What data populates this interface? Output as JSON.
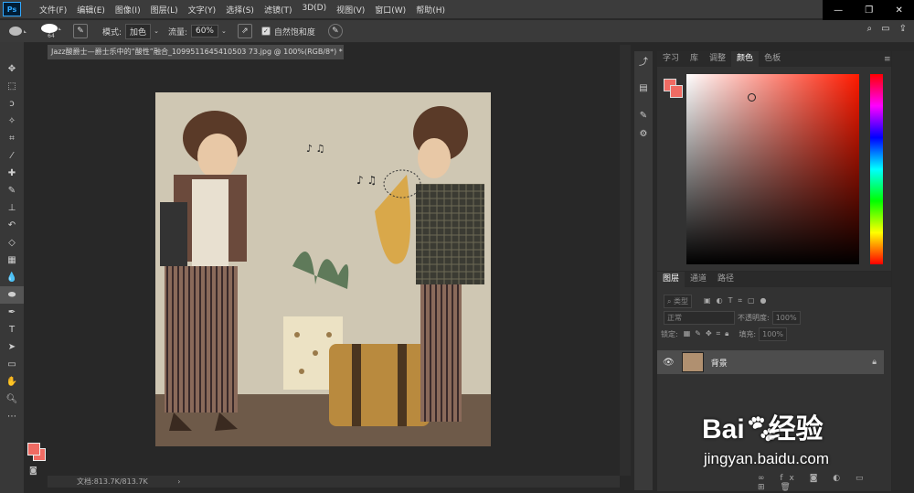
{
  "menubar": {
    "logo": "Ps",
    "items": [
      "文件(F)",
      "编辑(E)",
      "图像(I)",
      "图层(L)",
      "文字(Y)",
      "选择(S)",
      "滤镜(T)",
      "3D(D)",
      "视图(V)",
      "窗口(W)",
      "帮助(H)"
    ]
  },
  "window_controls": {
    "minimize": "—",
    "restore": "❐",
    "close": "✕"
  },
  "options": {
    "brush_size": "64",
    "mode_label": "模式:",
    "mode_value": "加色",
    "flow_label": "流量:",
    "flow_value": "60%",
    "saturation_label": "自然饱和度"
  },
  "document": {
    "tab_title": "Jazz酸爵士—爵士乐中的“酸性”融合_1099511645410503 73.jpg @ 100%(RGB/8*) *",
    "status": "文档:813.7K/813.7K"
  },
  "color_panel": {
    "tabs": [
      "字习",
      "库",
      "调整",
      "颜色",
      "色板"
    ],
    "active_tab": "颜色",
    "foreground_color": "#f06b63",
    "hue_base": "#ff1a00"
  },
  "layers_panel": {
    "tabs": [
      "图层",
      "通道",
      "路径"
    ],
    "active_tab": "图层",
    "filter_label": "类型",
    "blend_mode": "正常",
    "opacity_label": "不透明度:",
    "opacity_value": "100%",
    "lock_label": "锁定:",
    "fill_label": "填充:",
    "fill_value": "100%",
    "layer_name": "背景"
  },
  "watermark": {
    "brand": "Bai",
    "brand2": "经验",
    "url": "jingyan.baidu.com"
  }
}
